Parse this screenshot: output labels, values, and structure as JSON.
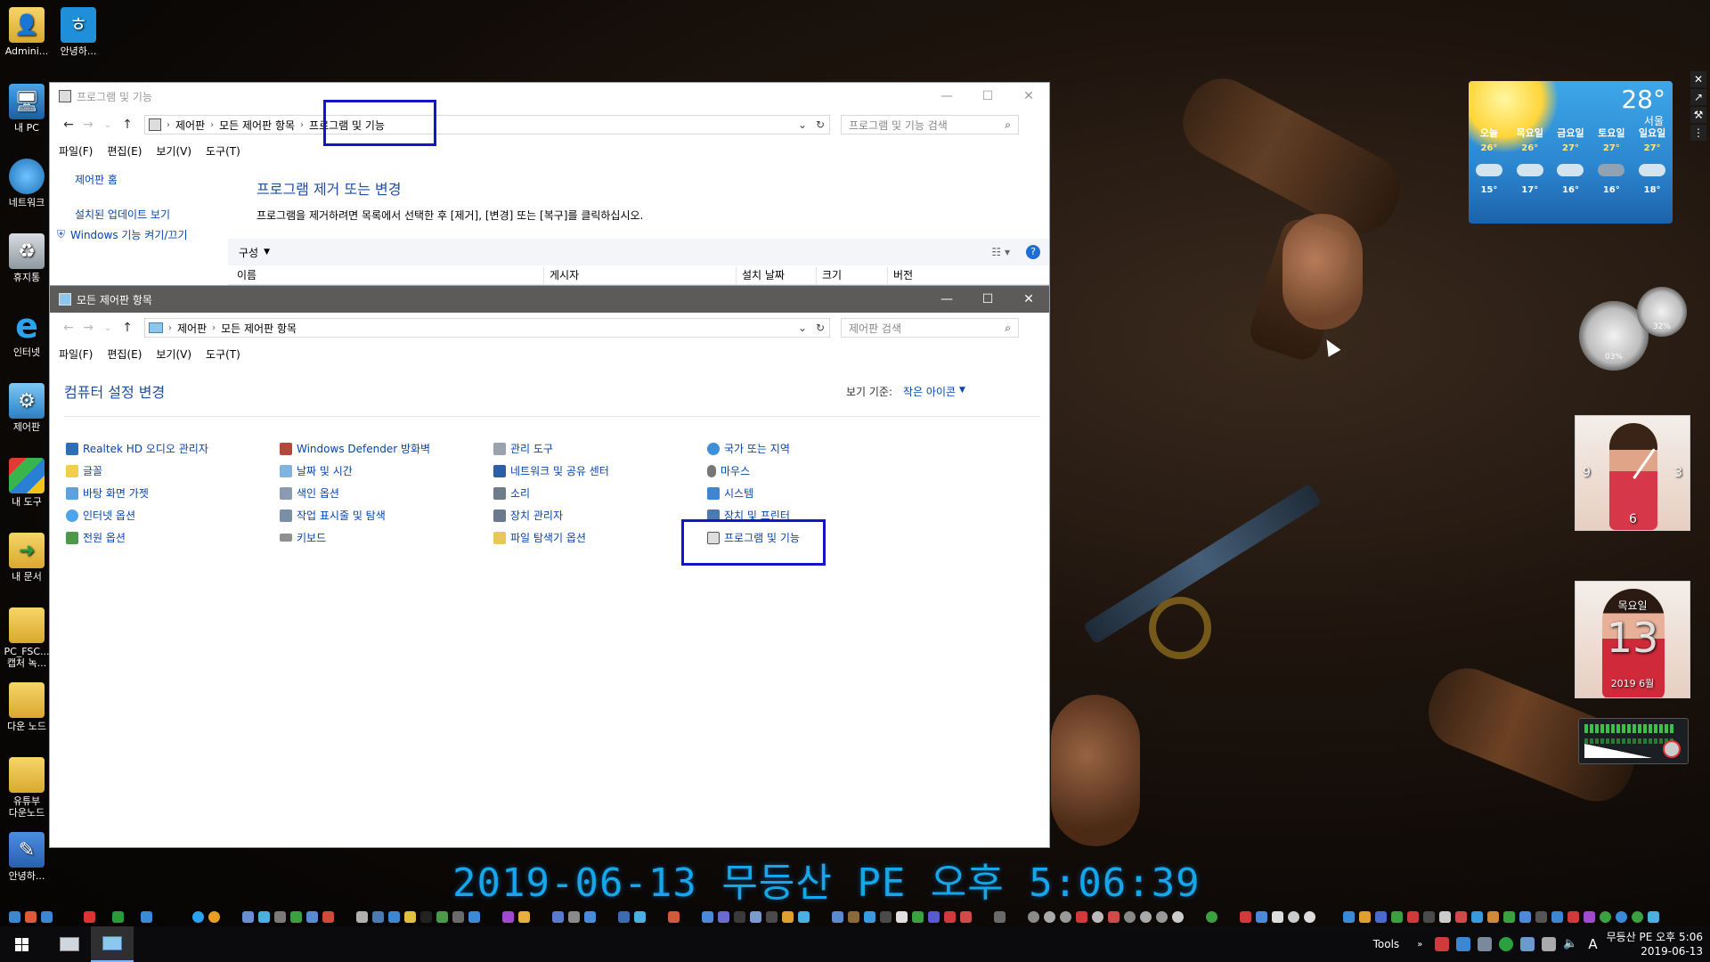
{
  "desktop": {
    "icons": [
      "Admini...",
      "안녕하...",
      "내 PC",
      "네트워크",
      "휴지통",
      "인터넷",
      "제어판",
      "내 도구",
      "내 문서",
      "PC_FSC...\n캡처 녹...",
      "다운 노드",
      "유튜부\n다운노드",
      "안녕하..."
    ]
  },
  "back_window": {
    "title": "프로그램 및 기능",
    "breadcrumb": [
      "제어판",
      "모든 제어판 항목",
      "프로그램 및 기능"
    ],
    "search_placeholder": "프로그램 및 기능 검색",
    "menu": [
      "파일(F)",
      "편집(E)",
      "보기(V)",
      "도구(T)"
    ],
    "sidebar": [
      "제어판 홈",
      "설치된 업데이트 보기",
      "Windows 기능 켜기/끄기"
    ],
    "heading": "프로그램 제거 또는 변경",
    "description": "프로그램을 제거하려면 목록에서 선택한 후 [제거], [변경] 또는 [복구]를 클릭하십시오.",
    "toolbar_organize": "구성",
    "columns": [
      "이름",
      "게시자",
      "설치 날짜",
      "크기",
      "버전"
    ]
  },
  "front_window": {
    "title": "모든 제어판 항목",
    "breadcrumb": [
      "제어판",
      "모든 제어판 항목"
    ],
    "search_placeholder": "제어판 검색",
    "menu": [
      "파일(F)",
      "편집(E)",
      "보기(V)",
      "도구(T)"
    ],
    "heading": "컴퓨터 설정 변경",
    "view_by_label": "보기 기준:",
    "view_by_value": "작은 아이콘",
    "items": [
      [
        "Realtek HD 오디오 관리자",
        "Windows Defender 방화벽",
        "관리 도구",
        "국가 또는 지역"
      ],
      [
        "글꼴",
        "날짜 및 시간",
        "네트워크 및 공유 센터",
        "마우스"
      ],
      [
        "바탕 화면 가젯",
        "색인 옵션",
        "소리",
        "시스템"
      ],
      [
        "인터넷 옵션",
        "작업 표시줄 및 탐색",
        "장치 관리자",
        "장치 및 프린터"
      ],
      [
        "전원 옵션",
        "키보드",
        "파일 탐색기 옵션",
        "프로그램 및 기능"
      ]
    ]
  },
  "weather": {
    "temp": "28°",
    "city": "서울",
    "days": [
      {
        "name": "오늘",
        "high": "26°",
        "low": "15°"
      },
      {
        "name": "목요일",
        "high": "26°",
        "low": "17°"
      },
      {
        "name": "금요일",
        "high": "27°",
        "low": "16°"
      },
      {
        "name": "토요일",
        "high": "27°",
        "low": "16°"
      },
      {
        "name": "일요일",
        "high": "27°",
        "low": "18°"
      }
    ]
  },
  "gauges": {
    "cpu": "03%",
    "mem": "32%"
  },
  "clock_widget": {
    "n9": "9",
    "n3": "3",
    "n6": "6"
  },
  "calendar_widget": {
    "day_name": "목요일",
    "day": "13",
    "month": "2019 6월"
  },
  "big_clock": "2019-06-13 무등산 PE 오후 5:06:39",
  "taskbar": {
    "tools_label": "Tools",
    "tray_A": "A",
    "time_line": "무등산 PE 오후 5:06",
    "date_line": "2019-06-13"
  },
  "colors": {
    "highlight": "#1414c8",
    "link": "#0645ad",
    "clock": "#16a7e8"
  }
}
